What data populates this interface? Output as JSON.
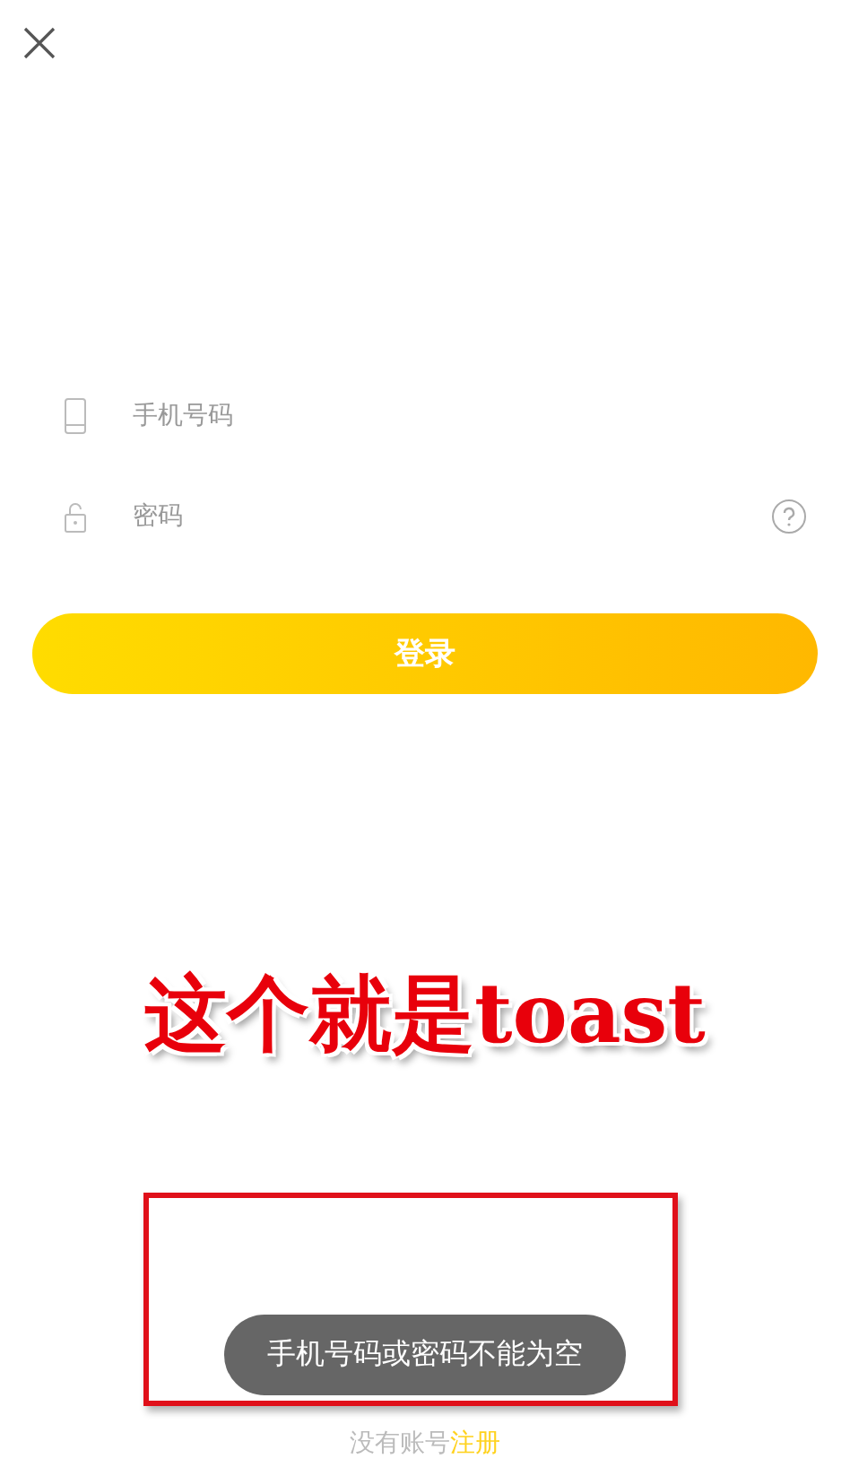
{
  "fields": [
    {
      "kind": "phone",
      "placeholder": "手机号码"
    },
    {
      "kind": "password",
      "placeholder": "密码"
    }
  ],
  "login_button": {
    "label": "登录"
  },
  "annotation": {
    "text": "这个就是toast"
  },
  "toast": {
    "text": "手机号码或密码不能为空"
  },
  "footer": {
    "prompt": "没有账号",
    "link": "注册"
  }
}
